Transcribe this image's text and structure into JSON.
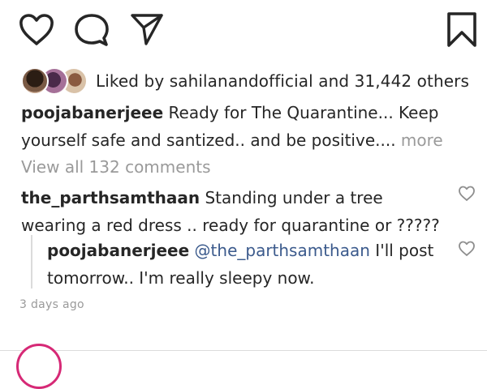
{
  "actions": {
    "like_icon": "heart-outline-icon",
    "comment_icon": "speech-bubble-icon",
    "share_icon": "paper-plane-icon",
    "save_icon": "bookmark-icon"
  },
  "likes": {
    "prefix": "Liked by ",
    "user": "sahilanandofficial",
    "middle": " and ",
    "count": "31,442 others"
  },
  "post": {
    "username": "poojabanerjeee",
    "caption": "Ready for The Quarantine... Keep yourself safe and santized.. and be positive....",
    "more": " more"
  },
  "comments": {
    "view_all": "View all 132 comments",
    "items": [
      {
        "username": "the_parthsamthaan",
        "text": "Standing under a tree wearing a red dress .. ready for quarantine or ?????"
      }
    ],
    "reply": {
      "username": "poojabanerjeee",
      "mention": "@the_parthsamthaan",
      "text": "I'll post tomorrow.. I'm really sleepy now."
    }
  },
  "timestamp": "3 days ago",
  "colors": {
    "text": "#262626",
    "muted": "#9a9a9a",
    "mention": "#3b5a8c",
    "story_ring": "#d62976"
  }
}
